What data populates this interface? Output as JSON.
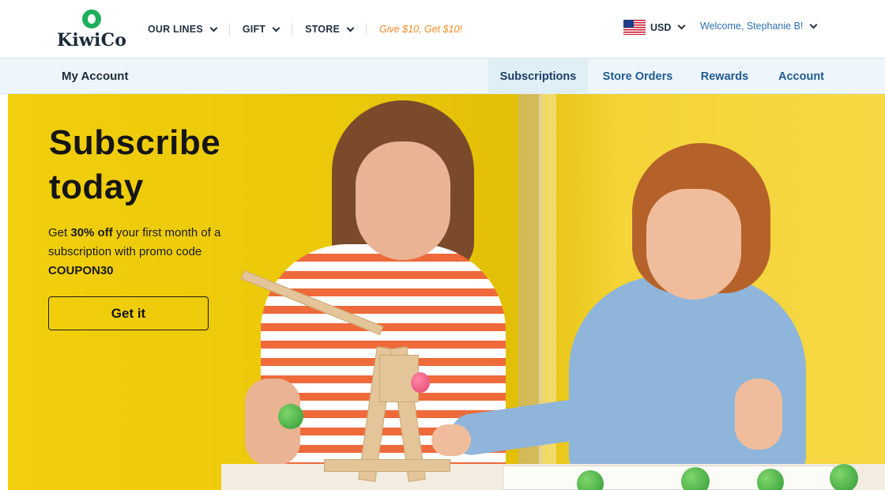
{
  "header": {
    "logo_text": "KiwiCo",
    "nav": {
      "our_lines": "OUR LINES",
      "gift": "GIFT",
      "store": "STORE",
      "promo": "Give $10, Get $10!"
    },
    "currency": "USD",
    "welcome": "Welcome, Stephanie B!"
  },
  "subnav": {
    "title": "My Account",
    "tabs": [
      {
        "label": "Subscriptions",
        "active": true
      },
      {
        "label": "Store Orders",
        "active": false
      },
      {
        "label": "Rewards",
        "active": false
      },
      {
        "label": "Account",
        "active": false
      }
    ]
  },
  "hero": {
    "title_line1": "Subscribe",
    "title_line2": "today",
    "copy_prefix": "Get",
    "copy_bold": "30% off",
    "copy_middle": "your first month of a subscription with promo code",
    "promo_code": "COUPON30",
    "cta_label": "Get it"
  },
  "colors": {
    "brand_green": "#1fae5e",
    "promo_orange": "#f08a24",
    "link_blue": "#2f6fb3",
    "hero_yellow": "#f2cf0c"
  }
}
